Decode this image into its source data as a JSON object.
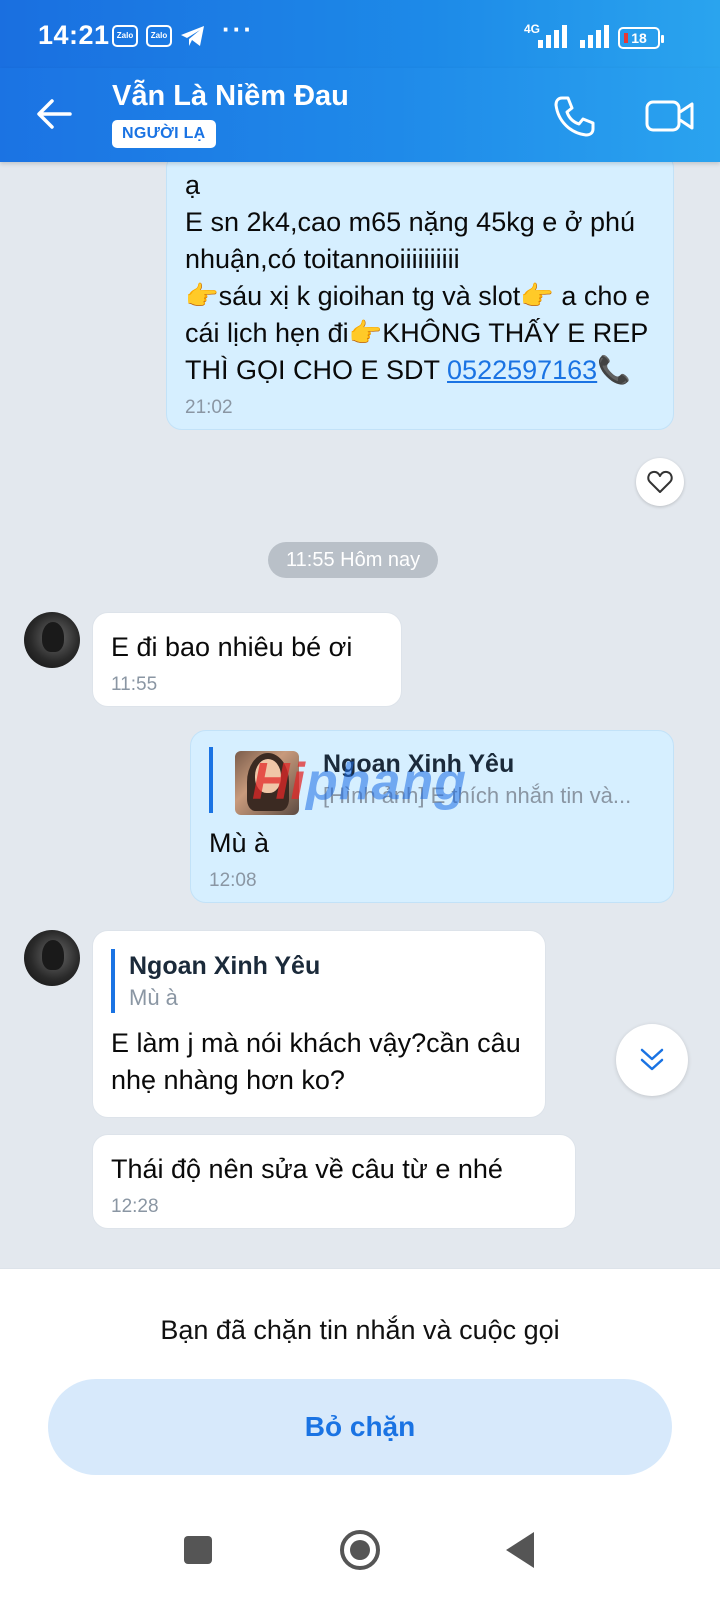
{
  "status_bar": {
    "time": "14:21",
    "app_icons": [
      "Zalo",
      "Zalo"
    ],
    "telegram_icon": "telegram-icon",
    "more": "···",
    "network": "4G",
    "battery": "18"
  },
  "header": {
    "title": "Vẫn Là Niềm Đau",
    "badge": "NGƯỜI LẠ",
    "back_icon": "back-arrow-icon",
    "call_icon": "phone-icon",
    "video_icon": "video-call-icon"
  },
  "messages": {
    "m1": {
      "text": "ạ\nE sn 2k4,cao m65 nặng 45kg e ở phú nhuận,có toitannoiiiiiiiiii\n👉sáu xị k gioihan tg và slot👉 a cho e cái lịch hẹn đi👉KHÔNG THẤY E REP THÌ GỌI CHO E SDT ",
      "phone": "0522597163",
      "phone_icon": "📞",
      "time": "21:02"
    },
    "date_divider": "11:55 Hôm nay",
    "m2": {
      "text": "E đi bao nhiêu bé ơi",
      "time": "11:55"
    },
    "m3": {
      "reply_name": "Ngoan Xinh Yêu",
      "reply_text": "[Hình ảnh] E thích nhắn tin và...",
      "text": "Mù à",
      "time": "12:08"
    },
    "m4": {
      "reply_name": "Ngoan Xinh Yêu",
      "reply_text": "Mù à",
      "text": "E làm j mà nói khách vậy?cần câu nhẹ nhàng hơn ko?"
    },
    "m5": {
      "text": "Thái độ nên sửa về câu từ e nhé",
      "time": "12:28"
    }
  },
  "watermark": {
    "part1": "Hi",
    "part2": "phang"
  },
  "blocked": {
    "text": "Bạn đã chặn tin nhắn và cuộc gọi",
    "button": "Bỏ chặn"
  },
  "colors": {
    "header_blue": "#1b73e3",
    "outgoing_bubble": "#d6efff",
    "incoming_bubble": "#ffffff",
    "accent": "#1a73e3"
  }
}
